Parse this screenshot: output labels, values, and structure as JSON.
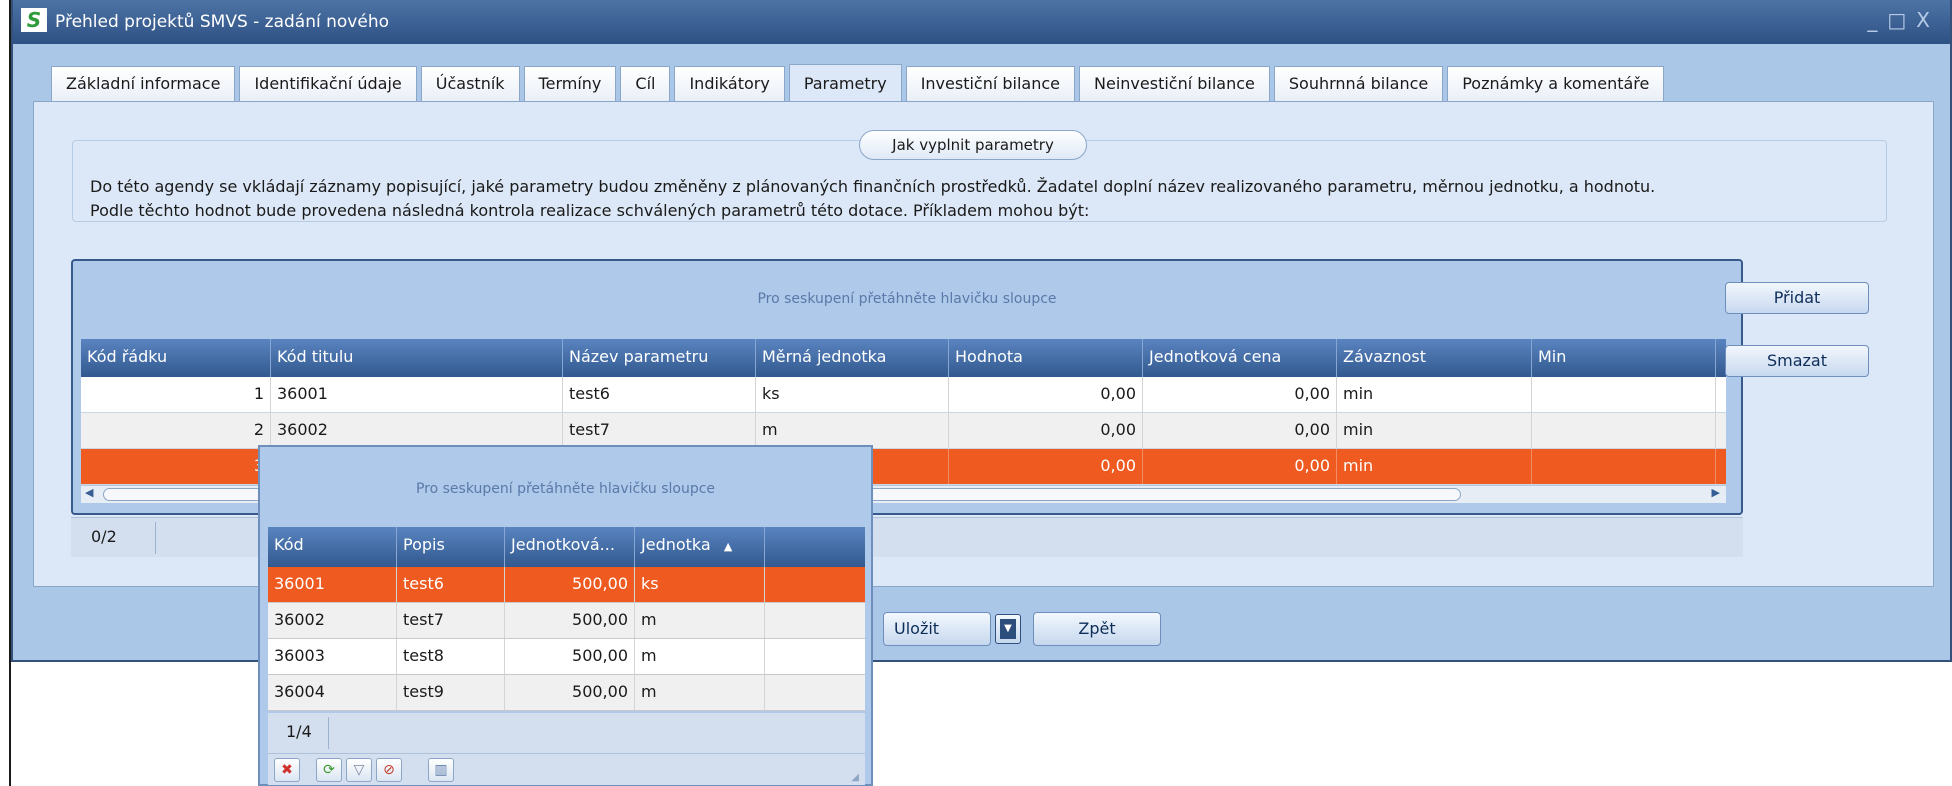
{
  "window": {
    "title": "Přehled projektů SMVS - zadání nového",
    "controls": [
      "_",
      "□",
      "X"
    ],
    "logo": "S"
  },
  "tabs": [
    {
      "label": "Základní informace",
      "active": false
    },
    {
      "label": "Identifikační údaje",
      "active": false
    },
    {
      "label": "Účastník",
      "active": false
    },
    {
      "label": "Termíny",
      "active": false
    },
    {
      "label": "Cíl",
      "active": false
    },
    {
      "label": "Indikátory",
      "active": false
    },
    {
      "label": "Parametry",
      "active": true
    },
    {
      "label": "Investiční bilance",
      "active": false
    },
    {
      "label": "Neinvestiční bilance",
      "active": false
    },
    {
      "label": "Souhrnná bilance",
      "active": false
    },
    {
      "label": "Poznámky a komentáře",
      "active": false
    }
  ],
  "help": {
    "title": "Jak vyplnit parametry",
    "line1": "Do této agendy se vkládají záznamy popisující, jaké parametry budou změněny z plánovaných finančních prostředků. Žadatel doplní název realizovaného parametru, měrnou jednotku, a hodnotu.",
    "line2": "Podle těchto hodnot bude provedena následná kontrola realizace schválených parametrů této dotace. Příkladem mohou být:"
  },
  "grid": {
    "group_hint": "Pro seskupení přetáhněte hlavičku sloupce",
    "columns": [
      "Kód řádku",
      "Kód titulu",
      "Název parametru",
      "Měrná jednotka",
      "Hodnota",
      "Jednotková cena",
      "Závaznost",
      "Min"
    ],
    "rows": [
      {
        "kod_radku": "1",
        "kod_titulu": "36001",
        "nazev": "test6",
        "jednotka": "ks",
        "hodnota": "0,00",
        "cena": "0,00",
        "zavaznost": "min",
        "min": ""
      },
      {
        "kod_radku": "2",
        "kod_titulu": "36002",
        "nazev": "test7",
        "jednotka": "m",
        "hodnota": "0,00",
        "cena": "0,00",
        "zavaznost": "min",
        "min": ""
      },
      {
        "kod_radku": "3",
        "kod_titulu": "",
        "nazev": "",
        "jednotka": "",
        "hodnota": "0,00",
        "cena": "0,00",
        "zavaznost": "min",
        "min": ""
      }
    ],
    "pager": "0/2"
  },
  "buttons": {
    "add": "Přidat",
    "delete": "Smazat",
    "save": "Uložit",
    "back": "Zpět"
  },
  "lookup": {
    "group_hint": "Pro seskupení přetáhněte hlavičku sloupce",
    "columns": [
      "Kód",
      "Popis",
      "Jednotková...",
      "Jednotka"
    ],
    "sort_indicator": "▲",
    "rows": [
      {
        "kod": "36001",
        "popis": "test6",
        "cena": "500,00",
        "jednotka": "ks"
      },
      {
        "kod": "36002",
        "popis": "test7",
        "cena": "500,00",
        "jednotka": "m"
      },
      {
        "kod": "36003",
        "popis": "test8",
        "cena": "500,00",
        "jednotka": "m"
      },
      {
        "kod": "36004",
        "popis": "test9",
        "cena": "500,00",
        "jednotka": "m"
      }
    ],
    "pager": "1/4"
  },
  "colors": {
    "selection": "#ee5a1f",
    "header": "#32598f",
    "panel": "#dce8f7"
  }
}
